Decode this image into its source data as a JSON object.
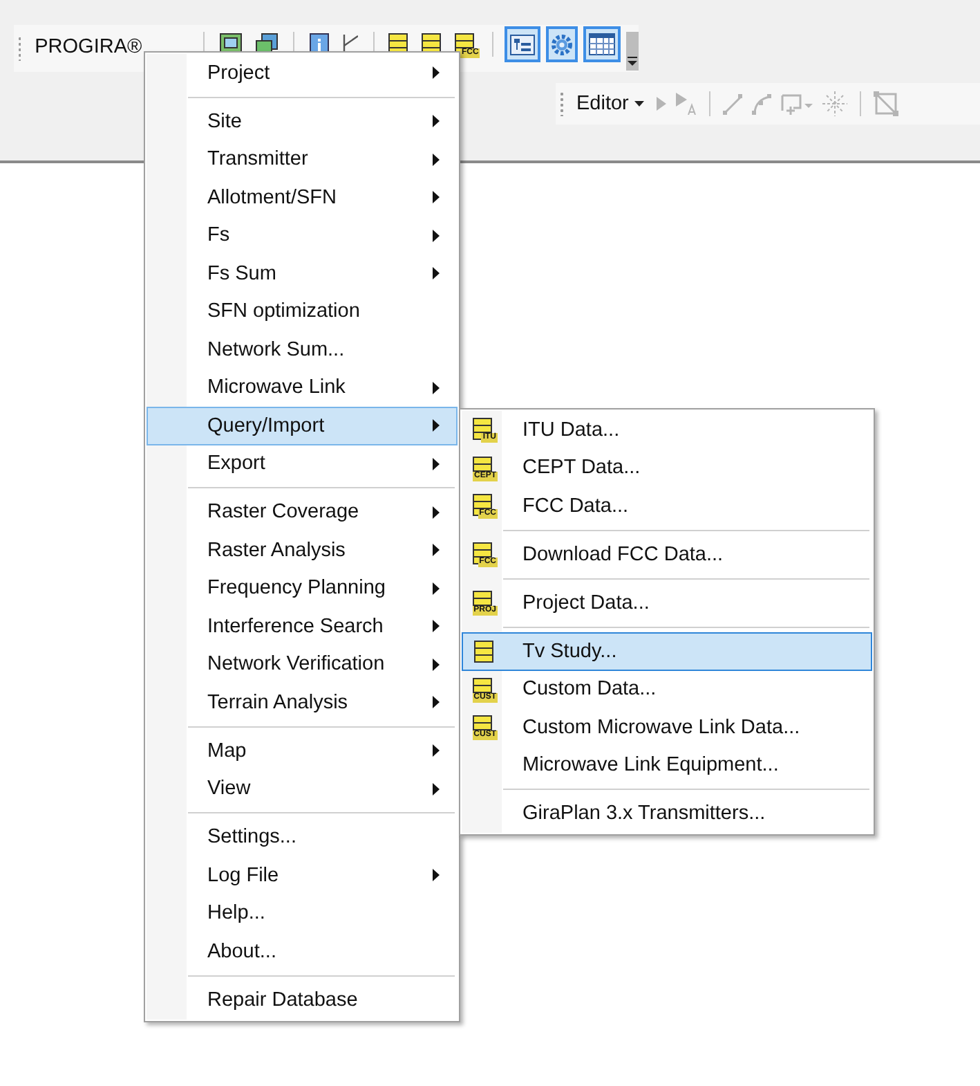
{
  "toolbar": {
    "title": "PROGIRA®",
    "tools": [
      {
        "kind": "frame",
        "selected": false
      },
      {
        "kind": "copy",
        "selected": false
      },
      {
        "kind": "info",
        "selected": false
      },
      {
        "kind": "pen",
        "selected": false
      },
      {
        "kind": "db",
        "selected": false
      },
      {
        "kind": "db",
        "selected": false
      },
      {
        "kind": "db-tag",
        "tag": "FCC",
        "selected": false
      },
      {
        "kind": "tree",
        "selected": true
      },
      {
        "kind": "gear",
        "selected": true
      },
      {
        "kind": "grid",
        "selected": true
      }
    ]
  },
  "editor_toolbar": {
    "label": "Editor"
  },
  "menu": {
    "items": [
      {
        "kind": "item",
        "label": "Project",
        "submenu": true,
        "selected": false
      },
      {
        "kind": "separator"
      },
      {
        "kind": "item",
        "label": "Site",
        "submenu": true,
        "selected": false
      },
      {
        "kind": "item",
        "label": "Transmitter",
        "submenu": true,
        "selected": false
      },
      {
        "kind": "item",
        "label": "Allotment/SFN",
        "submenu": true,
        "selected": false
      },
      {
        "kind": "item",
        "label": "Fs",
        "submenu": true,
        "selected": false
      },
      {
        "kind": "item",
        "label": "Fs Sum",
        "submenu": true,
        "selected": false
      },
      {
        "kind": "item",
        "label": "SFN optimization",
        "submenu": false,
        "selected": false
      },
      {
        "kind": "item",
        "label": "Network Sum...",
        "submenu": false,
        "selected": false
      },
      {
        "kind": "item",
        "label": "Microwave Link",
        "submenu": true,
        "selected": false
      },
      {
        "kind": "item",
        "label": "Query/Import",
        "submenu": true,
        "selected": true
      },
      {
        "kind": "item",
        "label": "Export",
        "submenu": true,
        "selected": false
      },
      {
        "kind": "separator"
      },
      {
        "kind": "item",
        "label": "Raster Coverage",
        "submenu": true,
        "selected": false
      },
      {
        "kind": "item",
        "label": "Raster Analysis",
        "submenu": true,
        "selected": false
      },
      {
        "kind": "item",
        "label": "Frequency Planning",
        "submenu": true,
        "selected": false
      },
      {
        "kind": "item",
        "label": "Interference Search",
        "submenu": true,
        "selected": false
      },
      {
        "kind": "item",
        "label": "Network Verification",
        "submenu": true,
        "selected": false
      },
      {
        "kind": "item",
        "label": "Terrain Analysis",
        "submenu": true,
        "selected": false
      },
      {
        "kind": "separator"
      },
      {
        "kind": "item",
        "label": "Map",
        "submenu": true,
        "selected": false
      },
      {
        "kind": "item",
        "label": "View",
        "submenu": true,
        "selected": false
      },
      {
        "kind": "separator"
      },
      {
        "kind": "item",
        "label": "Settings...",
        "submenu": false,
        "selected": false
      },
      {
        "kind": "item",
        "label": "Log File",
        "submenu": true,
        "selected": false
      },
      {
        "kind": "item",
        "label": "Help...",
        "submenu": false,
        "selected": false
      },
      {
        "kind": "item",
        "label": "About...",
        "submenu": false,
        "selected": false
      },
      {
        "kind": "separator"
      },
      {
        "kind": "item",
        "label": "Repair Database",
        "submenu": false,
        "selected": false
      }
    ]
  },
  "submenu": {
    "items": [
      {
        "kind": "item",
        "label": "ITU Data...",
        "icon_tag": "ITU",
        "selected": false
      },
      {
        "kind": "item",
        "label": "CEPT Data...",
        "icon_tag": "CEPT",
        "selected": false
      },
      {
        "kind": "item",
        "label": "FCC Data...",
        "icon_tag": "FCC",
        "selected": false
      },
      {
        "kind": "separator"
      },
      {
        "kind": "item",
        "label": "Download FCC Data...",
        "icon_tag": "FCC",
        "selected": false
      },
      {
        "kind": "separator"
      },
      {
        "kind": "item",
        "label": "Project Data...",
        "icon_tag": "PROJ",
        "selected": false
      },
      {
        "kind": "separator"
      },
      {
        "kind": "icon-item",
        "label": "Tv Study...",
        "selected": true
      },
      {
        "kind": "item",
        "label": "Custom Data...",
        "icon_tag": "CUST",
        "selected": false
      },
      {
        "kind": "item",
        "label": "Custom Microwave Link Data...",
        "icon_tag": "CUST",
        "selected": false
      },
      {
        "kind": "item",
        "label": "Microwave Link Equipment...",
        "selected": false
      },
      {
        "kind": "separator"
      },
      {
        "kind": "item",
        "label": "GiraPlan 3.x Transmitters...",
        "selected": false
      }
    ]
  }
}
